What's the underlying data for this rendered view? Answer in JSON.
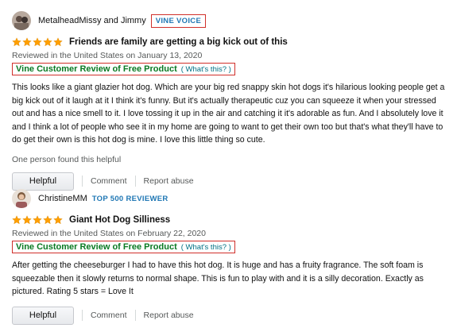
{
  "colors": {
    "star": "#ff9f00",
    "vine_green": "#0a7a23",
    "badge_blue": "#1f77b4",
    "highlight_box": "#d0302b"
  },
  "reviews": [
    {
      "author": "MetalheadMissy and Jimmy",
      "avatar_icon": "user-avatar-icon",
      "badge": "VINE VOICE",
      "rating": 5,
      "title": "Friends are family are getting a big kick out of this",
      "meta": "Reviewed in the United States on January 13, 2020",
      "vine_label": "Vine Customer Review of Free Product",
      "whats_this": "( What's this? )",
      "body": "This looks like a giant glazier hot dog. Which are your big red snappy skin hot dogs it's hilarious looking people get a big kick out of it laugh at it I think it's funny. But it's actually therapeutic cuz you can squeeze it when your stressed out and has a nice smell to it. I love tossing it up in the air and catching it it's adorable as fun. And I absolutely love it and I think a lot of people who see it in my home are going to want to get their own too but that's what they'll have to do get their own is this hot dog is mine. I love this little thing so cute.",
      "helpful_count": "One person found this helpful",
      "helpful_label": "Helpful",
      "comment_label": "Comment",
      "report_label": "Report abuse"
    },
    {
      "author": "ChristineMM",
      "avatar_icon": "user-avatar-icon",
      "badge": "TOP 500 REVIEWER",
      "rating": 5,
      "title": "Giant Hot Dog Silliness",
      "meta": "Reviewed in the United States on February 22, 2020",
      "vine_label": "Vine Customer Review of Free Product",
      "whats_this": "( What's this? )",
      "body": "After getting the cheeseburger I had to have this hot dog. It is huge and has a fruity fragrance. The soft foam is squeezable then it slowly returns to normal shape. This is fun to play with and it is a silly decoration. Exactly as pictured. Rating 5 stars = Love It",
      "helpful_label": "Helpful",
      "comment_label": "Comment",
      "report_label": "Report abuse"
    }
  ]
}
